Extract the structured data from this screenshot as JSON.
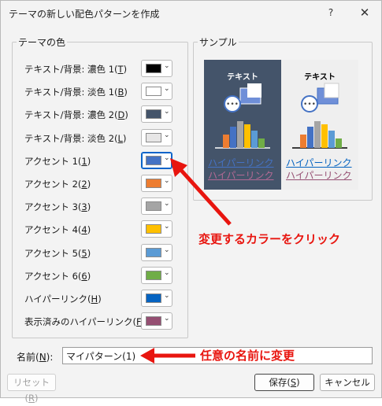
{
  "dialog": {
    "title": "テーマの新しい配色パターンを作成",
    "help_glyph": "?",
    "close_glyph": "✕"
  },
  "theme_colors": {
    "group_label": "テーマの色",
    "rows": [
      {
        "label": "テキスト/背景: 濃色 1(",
        "key": "T",
        "color": "#000000"
      },
      {
        "label": "テキスト/背景: 淡色 1(",
        "key": "B",
        "color": "#ffffff"
      },
      {
        "label": "テキスト/背景: 濃色 2(",
        "key": "D",
        "color": "#44546a"
      },
      {
        "label": "テキスト/背景: 淡色 2(",
        "key": "L",
        "color": "#e7e6e6"
      },
      {
        "label": "アクセント 1(",
        "key": "1",
        "color": "#4472c4"
      },
      {
        "label": "アクセント 2(",
        "key": "2",
        "color": "#ed7d31"
      },
      {
        "label": "アクセント 3(",
        "key": "3",
        "color": "#a5a5a5"
      },
      {
        "label": "アクセント 4(",
        "key": "4",
        "color": "#ffc000"
      },
      {
        "label": "アクセント 5(",
        "key": "5",
        "color": "#5b9bd5"
      },
      {
        "label": "アクセント 6(",
        "key": "6",
        "color": "#70ad47"
      },
      {
        "label": "ハイパーリンク(",
        "key": "H",
        "color": "#0563c1"
      },
      {
        "label": "表示済みのハイパーリンク(",
        "key": "F",
        "color": "#954f72"
      }
    ],
    "selected_index": 4
  },
  "sample": {
    "group_label": "サンプル",
    "text_label": "テキスト",
    "hyperlink": "ハイパーリンク",
    "visited_hyperlink": "ハイパーリンク",
    "dark_link_color": "#4472c4",
    "dark_visited_color": "#a05a85",
    "light_link_color": "#0563c1",
    "light_visited_color": "#954f72"
  },
  "name_field": {
    "label_prefix": "名前(",
    "label_key": "N",
    "label_suffix": "):",
    "value": "マイパターン(1)"
  },
  "buttons": {
    "reset_label": "リセット(",
    "reset_key": "R",
    "save_label": "保存(",
    "save_key": "S",
    "cancel_label": "キャンセル"
  },
  "annotations": {
    "click_color": "変更するカラーをクリック",
    "rename": "任意の名前に変更",
    "color": "#e8150f"
  }
}
